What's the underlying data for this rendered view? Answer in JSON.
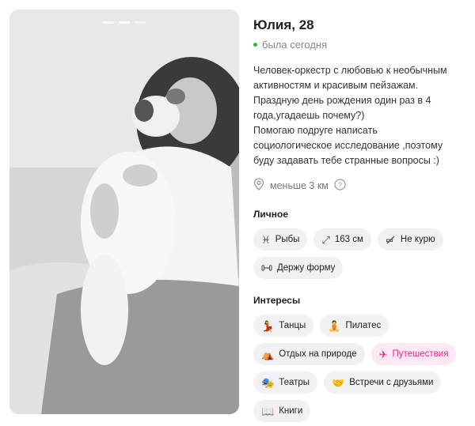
{
  "profile": {
    "name_age": "Юлия, 28",
    "status": "была сегодня",
    "bio": "Человек-оркестр с любовью к необычным\nактивностям и красивым пейзажам.\nПраздную день рождения один раз в 4\nгода,угадаешь почему?)\nПомогаю подруге написать\nсоциологическое исследование ,поэтому\nбуду задавать тебе странные вопросы :)",
    "distance": "меньше 3 км"
  },
  "personal": {
    "title": "Личное",
    "items": [
      {
        "label": "Рыбы",
        "icon": "pisces-icon"
      },
      {
        "label": "163 см",
        "icon": "height-icon"
      },
      {
        "label": "Не курю",
        "icon": "no-smoking-icon"
      },
      {
        "label": "Держу форму",
        "icon": "dumbbell-icon"
      }
    ]
  },
  "interests": {
    "title": "Интересы",
    "items": [
      {
        "label": "Танцы",
        "icon": "dancer-icon",
        "glyph": "💃"
      },
      {
        "label": "Пилатес",
        "icon": "pilates-icon",
        "glyph": "🧘"
      },
      {
        "label": "Отдых на природе",
        "icon": "camping-icon",
        "glyph": "⛺"
      },
      {
        "label": "Путешествия",
        "icon": "airplane-icon",
        "glyph": "✈",
        "highlight": true
      },
      {
        "label": "Театры",
        "icon": "theater-masks-icon",
        "glyph": "🎭"
      },
      {
        "label": "Встречи с друзьями",
        "icon": "handshake-icon",
        "glyph": "🤝"
      },
      {
        "label": "Книги",
        "icon": "book-icon",
        "glyph": "📖"
      }
    ]
  },
  "colors": {
    "online": "#31b549",
    "chip_bg": "#f1f1f4",
    "highlight_bg": "#fde8f4",
    "highlight_text": "#e02a8c"
  }
}
